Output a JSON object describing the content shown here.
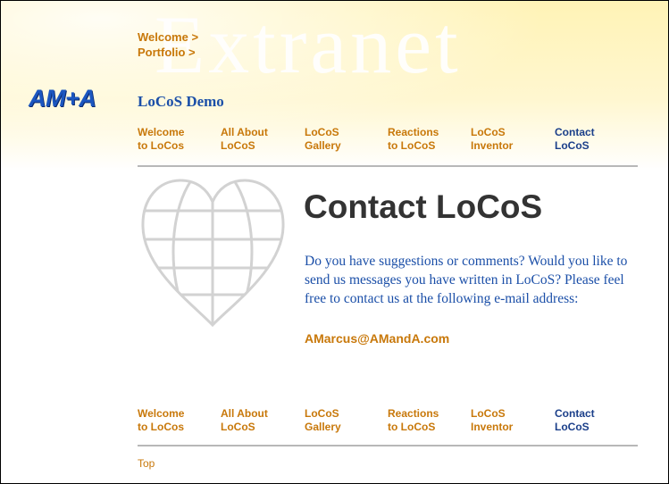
{
  "watermark": "Extranet",
  "breadcrumbs": [
    {
      "label": "Welcome >"
    },
    {
      "label": "Portfolio >"
    }
  ],
  "logo": "AM+A",
  "site_title": "LoCoS Demo",
  "nav": [
    {
      "label": "Welcome\nto LoCos"
    },
    {
      "label": "All About\nLoCoS"
    },
    {
      "label": "LoCoS\nGallery"
    },
    {
      "label": "Reactions\nto LoCoS"
    },
    {
      "label": "LoCoS\nInventor"
    },
    {
      "label": "Contact\nLoCoS",
      "active": true
    }
  ],
  "heading": "Contact LoCoS",
  "body_text": "Do you have suggestions or comments? Would you like to send us messages you have written in LoCoS? Please feel free to contact us at the following e-mail address:",
  "email": "AMarcus@AMandA.com",
  "top_link": "Top",
  "colors": {
    "link_orange": "#c8780a",
    "active_navy": "#1b3f8a",
    "body_blue": "#1b4fa8",
    "logo_blue": "#1b56c0",
    "header_yellow": "#fff3b6"
  },
  "icons": {
    "heart_globe": "heart-globe-icon"
  }
}
